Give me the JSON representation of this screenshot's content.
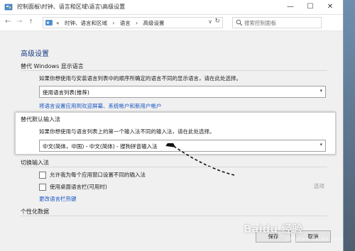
{
  "window": {
    "title": "控制面板\\时钟、语言和区域\\语言\\高级设置",
    "min_glyph": "—",
    "max_glyph": "☐",
    "close_glyph": "✕"
  },
  "nav": {
    "back_glyph": "←",
    "forward_glyph": "→",
    "up_glyph": "↑",
    "breadcrumb": [
      "«",
      "时钟、语言和区域",
      "›",
      "语言",
      "›",
      "高级设置"
    ],
    "dropdown_glyph": "∨",
    "refresh_glyph": "↻",
    "search_placeholder": "搜索控制面板"
  },
  "page": {
    "title": "高级设置",
    "override_display": {
      "title": "替代 Windows 显示语言",
      "desc": "如果你想使用与安装语言列表中的顺序所确定的语言不同的显示语言，请在此处选择。",
      "select_value": "使用语言列表(推荐)",
      "link": "将语言设置应用到欢迎屏幕、系统帐户和新用户帐户"
    },
    "override_input": {
      "title": "替代默认输入法",
      "desc": "如果你想使用与语言列表上的第一个输入法不同的输入法，请在此处选择。",
      "select_value": "中文(简体，中国) - 中文(简体) - 搜狗拼音输入法"
    },
    "switch_input": {
      "title": "切换输入法",
      "checkbox1": "允许我为每个应用窗口设置不同的输入法",
      "checkbox2": "使用桌面语言栏(可用时)",
      "options_link": "选项",
      "hotkey_link": "更改语言栏热键"
    },
    "personal": {
      "title": "个性化数据"
    },
    "buttons": {
      "save": "保存",
      "cancel": "取消"
    }
  },
  "watermark": {
    "main": "Baidu 经验",
    "sub": "jingyan.baidu.com"
  },
  "colors": {
    "title_blue": "#1e3f86",
    "link_blue": "#1a55c4",
    "arrow": "#111111"
  }
}
